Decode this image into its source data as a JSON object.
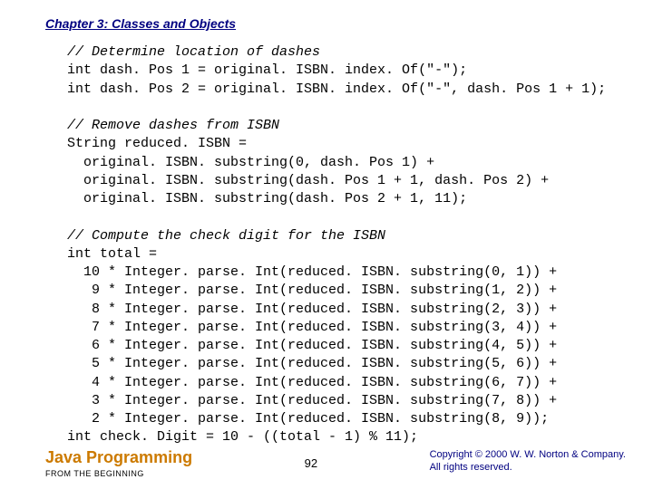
{
  "chapter": "Chapter 3: Classes and Objects",
  "code": {
    "c1": "// Determine location of dashes",
    "l2": "int dash. Pos 1 = original. ISBN. index. Of(\"-\");",
    "l3": "int dash. Pos 2 = original. ISBN. index. Of(\"-\", dash. Pos 1 + 1);",
    "c4": "// Remove dashes from ISBN",
    "l5": "String reduced. ISBN =",
    "l6": "  original. ISBN. substring(0, dash. Pos 1) +",
    "l7": "  original. ISBN. substring(dash. Pos 1 + 1, dash. Pos 2) +",
    "l8": "  original. ISBN. substring(dash. Pos 2 + 1, 11);",
    "c9": "// Compute the check digit for the ISBN",
    "l10": "int total =",
    "l11": "  10 * Integer. parse. Int(reduced. ISBN. substring(0, 1)) +",
    "l12": "   9 * Integer. parse. Int(reduced. ISBN. substring(1, 2)) +",
    "l13": "   8 * Integer. parse. Int(reduced. ISBN. substring(2, 3)) +",
    "l14": "   7 * Integer. parse. Int(reduced. ISBN. substring(3, 4)) +",
    "l15": "   6 * Integer. parse. Int(reduced. ISBN. substring(4, 5)) +",
    "l16": "   5 * Integer. parse. Int(reduced. ISBN. substring(5, 6)) +",
    "l17": "   4 * Integer. parse. Int(reduced. ISBN. substring(6, 7)) +",
    "l18": "   3 * Integer. parse. Int(reduced. ISBN. substring(7, 8)) +",
    "l19": "   2 * Integer. parse. Int(reduced. ISBN. substring(8, 9));",
    "l20": "int check. Digit = 10 - ((total - 1) % 11);"
  },
  "footer": {
    "brand": "Java Programming",
    "brand_sub": "FROM THE BEGINNING",
    "page": "92",
    "copy1": "Copyright © 2000 W. W. Norton & Company.",
    "copy2": "All rights reserved."
  }
}
